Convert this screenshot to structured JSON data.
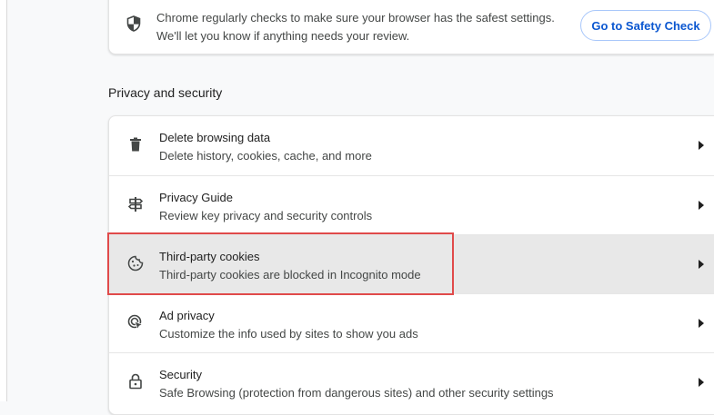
{
  "safety_check": {
    "line1": "Chrome regularly checks to make sure your browser has the safest settings.",
    "line2": "We'll let you know if anything needs your review.",
    "button_label": "Go to Safety Check",
    "icon": "shield-icon"
  },
  "privacy_section": {
    "title": "Privacy and security",
    "items": [
      {
        "title": "Delete browsing data",
        "subtitle": "Delete history, cookies, cache, and more",
        "icon": "trash-icon"
      },
      {
        "title": "Privacy Guide",
        "subtitle": "Review key privacy and security controls",
        "icon": "signpost-icon"
      },
      {
        "title": "Third-party cookies",
        "subtitle": "Third-party cookies are blocked in Incognito mode",
        "icon": "cookie-icon",
        "highlighted": true
      },
      {
        "title": "Ad privacy",
        "subtitle": "Customize the info used by sites to show you ads",
        "icon": "ad-privacy-icon"
      },
      {
        "title": "Security",
        "subtitle": "Safe Browsing (protection from dangerous sites) and other security settings",
        "icon": "lock-icon"
      }
    ]
  },
  "colors": {
    "accent": "#0b57d0",
    "highlight_row": "#e8e8e8",
    "annotation_border": "#e04a4a"
  }
}
